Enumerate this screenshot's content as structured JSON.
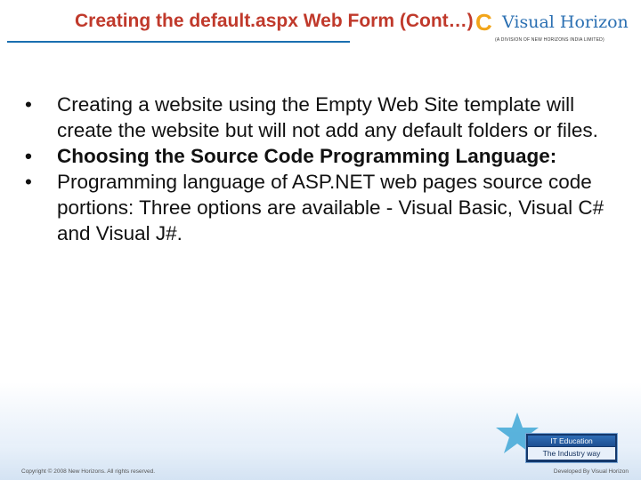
{
  "slide": {
    "title": "Creating the default.aspx Web Form (Cont…)",
    "logo": {
      "mark": "C",
      "wordmark": "Visual Horizon",
      "tagline": "(A DIVISION OF NEW HORIZONS INDIA LIMITED)"
    },
    "bullets": [
      {
        "marker": "•",
        "text": "Creating a website using the Empty Web Site template will create the website but will not add any default folders or files.",
        "bold": false
      },
      {
        "marker": "•",
        "text": "Choosing the Source Code Programming Language:",
        "bold": true
      },
      {
        "marker": "•",
        "text": "Programming language of ASP.NET web pages source code portions: Three options are available - Visual Basic, Visual C# and Visual J#.",
        "bold": false
      }
    ],
    "badge": {
      "line1": "IT Education",
      "line2": "The Industry way"
    },
    "footer": {
      "copyright": "Copyright © 2008 New Horizons. All rights reserved.",
      "credit": "Developed By Visual Horizon"
    }
  }
}
